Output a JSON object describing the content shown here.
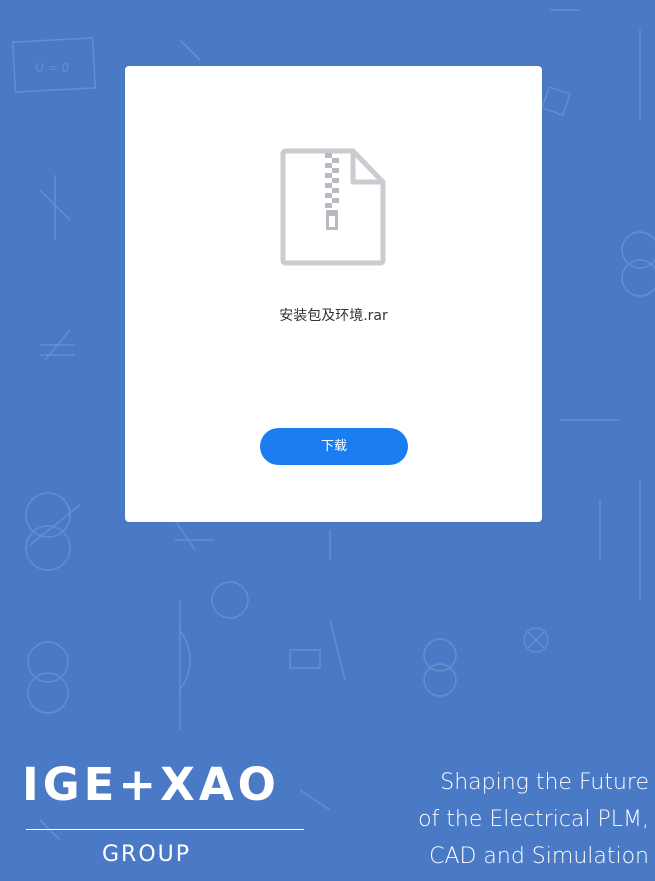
{
  "file": {
    "name": "安装包及环境.rar",
    "icon": "zip-file-icon"
  },
  "actions": {
    "download_label": "下载"
  },
  "brand": {
    "logo_text": "IGE+XAO",
    "group_text": "GROUP",
    "tagline_line1": "Shaping the Future",
    "tagline_line2": "of the Electrical PLM,",
    "tagline_line3": "CAD and Simulation"
  },
  "background_art": {
    "formula_label": "U = 0"
  },
  "colors": {
    "background": "#4a79c6",
    "card": "#ffffff",
    "button": "#1a7ef0",
    "icon_gray": "#c9ccd1"
  }
}
